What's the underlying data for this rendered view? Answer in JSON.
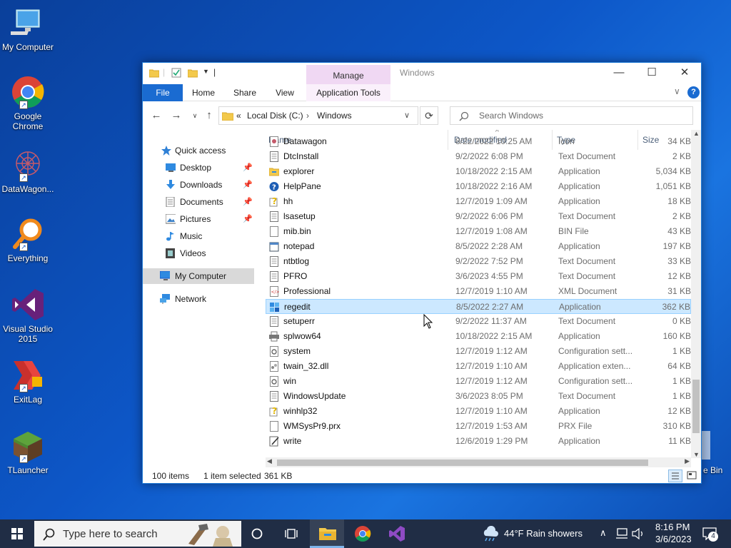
{
  "desktop": {
    "icons": [
      {
        "label": "My Computer"
      },
      {
        "label": "Google Chrome"
      },
      {
        "label": "DataWagon..."
      },
      {
        "label": "Everything"
      },
      {
        "label": "Visual Studio 2015"
      },
      {
        "label": "ExitLag"
      },
      {
        "label": "TLauncher"
      },
      {
        "label": "e Bin"
      }
    ]
  },
  "window": {
    "title": "Windows",
    "manage_tab": "Manage",
    "ribbon_tabs": [
      "File",
      "Home",
      "Share",
      "View",
      "Application Tools"
    ],
    "address": {
      "chevron": "«",
      "segments": [
        "Local Disk (C:)",
        "Windows"
      ]
    },
    "search_placeholder": "Search Windows",
    "nav_pane": [
      {
        "label": "Quick access",
        "icon": "star-icon"
      },
      {
        "label": "Desktop",
        "icon": "desktop-icon",
        "pinned": true
      },
      {
        "label": "Downloads",
        "icon": "download-icon",
        "pinned": true
      },
      {
        "label": "Documents",
        "icon": "document-icon",
        "pinned": true
      },
      {
        "label": "Pictures",
        "icon": "picture-icon",
        "pinned": true
      },
      {
        "label": "Music",
        "icon": "music-icon"
      },
      {
        "label": "Videos",
        "icon": "video-icon"
      },
      {
        "label": "My Computer",
        "icon": "computer-icon",
        "selected": true
      },
      {
        "label": "Network",
        "icon": "network-icon"
      }
    ],
    "columns": [
      "Name",
      "Date modified",
      "Type",
      "Size"
    ],
    "files": [
      {
        "name": "Datawagon",
        "date": "8/22/2022 10:25 AM",
        "type": "Icon",
        "size": "34 KB",
        "icon": "ico",
        "partial": true
      },
      {
        "name": "DtcInstall",
        "date": "9/2/2022 6:08 PM",
        "type": "Text Document",
        "size": "2 KB",
        "icon": "txt"
      },
      {
        "name": "explorer",
        "date": "10/18/2022 2:15 AM",
        "type": "Application",
        "size": "5,034 KB",
        "icon": "folder"
      },
      {
        "name": "HelpPane",
        "date": "10/18/2022 2:16 AM",
        "type": "Application",
        "size": "1,051 KB",
        "icon": "help"
      },
      {
        "name": "hh",
        "date": "12/7/2019 1:09 AM",
        "type": "Application",
        "size": "18 KB",
        "icon": "hh"
      },
      {
        "name": "lsasetup",
        "date": "9/2/2022 6:06 PM",
        "type": "Text Document",
        "size": "2 KB",
        "icon": "txt"
      },
      {
        "name": "mib.bin",
        "date": "12/7/2019 1:08 AM",
        "type": "BIN File",
        "size": "43 KB",
        "icon": "blank"
      },
      {
        "name": "notepad",
        "date": "8/5/2022 2:28 AM",
        "type": "Application",
        "size": "197 KB",
        "icon": "notepad"
      },
      {
        "name": "ntbtlog",
        "date": "9/2/2022 7:52 PM",
        "type": "Text Document",
        "size": "33 KB",
        "icon": "txt"
      },
      {
        "name": "PFRO",
        "date": "3/6/2023 4:55 PM",
        "type": "Text Document",
        "size": "12 KB",
        "icon": "txt"
      },
      {
        "name": "Professional",
        "date": "12/7/2019 1:10 AM",
        "type": "XML Document",
        "size": "31 KB",
        "icon": "xml"
      },
      {
        "name": "regedit",
        "date": "8/5/2022 2:27 AM",
        "type": "Application",
        "size": "362 KB",
        "icon": "regedit",
        "selected": true
      },
      {
        "name": "setuperr",
        "date": "9/2/2022 11:37 AM",
        "type": "Text Document",
        "size": "0 KB",
        "icon": "txt"
      },
      {
        "name": "splwow64",
        "date": "10/18/2022 2:15 AM",
        "type": "Application",
        "size": "160 KB",
        "icon": "printer"
      },
      {
        "name": "system",
        "date": "12/7/2019 1:12 AM",
        "type": "Configuration sett...",
        "size": "1 KB",
        "icon": "ini"
      },
      {
        "name": "twain_32.dll",
        "date": "12/7/2019 1:10 AM",
        "type": "Application exten...",
        "size": "64 KB",
        "icon": "dll"
      },
      {
        "name": "win",
        "date": "12/7/2019 1:12 AM",
        "type": "Configuration sett...",
        "size": "1 KB",
        "icon": "ini"
      },
      {
        "name": "WindowsUpdate",
        "date": "3/6/2023 8:05 PM",
        "type": "Text Document",
        "size": "1 KB",
        "icon": "txt"
      },
      {
        "name": "winhlp32",
        "date": "12/7/2019 1:10 AM",
        "type": "Application",
        "size": "12 KB",
        "icon": "hh"
      },
      {
        "name": "WMSysPr9.prx",
        "date": "12/7/2019 1:53 AM",
        "type": "PRX File",
        "size": "310 KB",
        "icon": "blank"
      },
      {
        "name": "write",
        "date": "12/6/2019 1:29 PM",
        "type": "Application",
        "size": "11 KB",
        "icon": "write"
      }
    ],
    "status": {
      "count": "100 items",
      "selected": "1 item selected",
      "size": "361 KB"
    }
  },
  "taskbar": {
    "search_placeholder": "Type here to search",
    "weather": "44°F  Rain showers",
    "time": "8:16 PM",
    "date": "3/6/2023",
    "notification_count": "4"
  },
  "colors": {
    "accent": "#1a6bd1",
    "selection": "#cce8ff",
    "manage": "#f0d8f3"
  }
}
